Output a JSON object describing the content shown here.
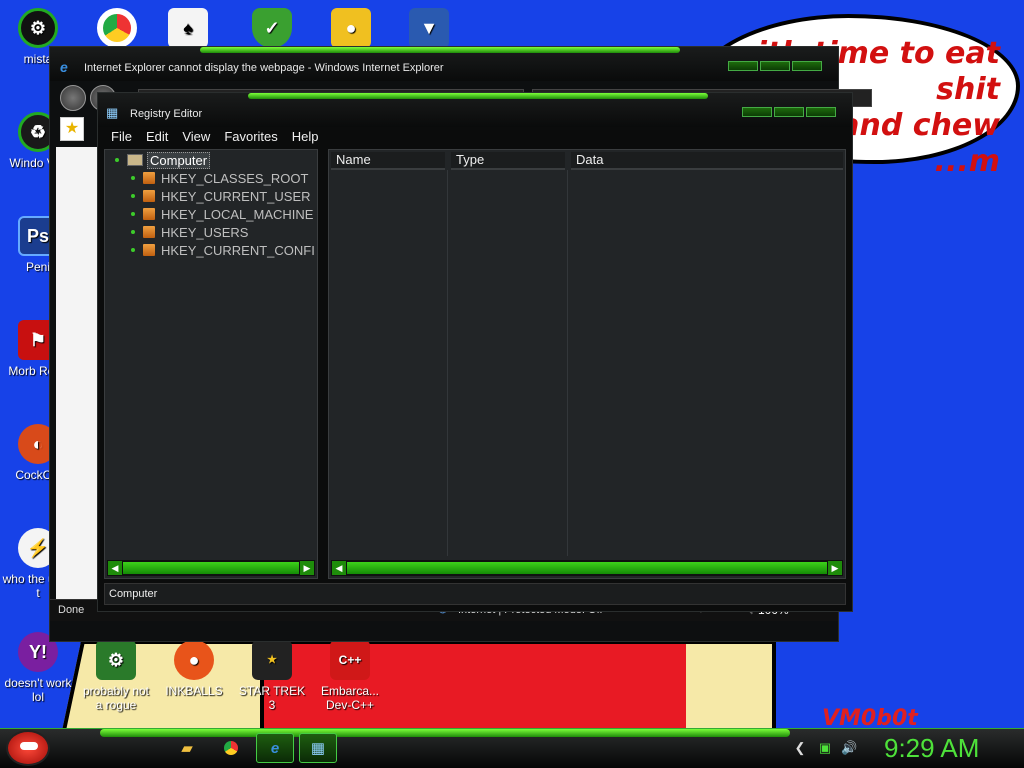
{
  "wallpaper": {
    "bubble_lines": [
      "...ith time to eat shit",
      "and chew",
      "...m"
    ],
    "signature": "VM0b0t"
  },
  "desktop_icons": [
    {
      "label": "mista",
      "icon": "gear-icon",
      "color": "#111"
    },
    {
      "label": "Windo Vist",
      "icon": "recycle-icon",
      "color": "#1a1a1a"
    },
    {
      "label": "Peni",
      "icon": "photoshop-icon",
      "color": "#1b3d8f"
    },
    {
      "label": "Morb Read",
      "icon": "pdf-icon",
      "color": "#c81010"
    },
    {
      "label": "CockClo",
      "icon": "browser-icon",
      "color": "#d84a1a"
    },
    {
      "label": "who the uses t",
      "icon": "lightning-icon",
      "color": "#e86010"
    },
    {
      "label": "doesn't work lol",
      "icon": "yahoo-messenger-icon",
      "color": "#7a1fa0"
    },
    {
      "label": "probably not a rogue",
      "icon": "gears-icon",
      "color": "#2a7a2a"
    },
    {
      "label": "INKBALLS",
      "icon": "inkball-icon",
      "color": "#e8541a"
    },
    {
      "label": "STAR TREK 3",
      "icon": "game-icon",
      "color": "#222"
    },
    {
      "label": "Embarca... Dev-C++",
      "icon": "devcpp-icon",
      "color": "#d01818"
    }
  ],
  "top_icons": [
    {
      "name": "chrome-icon",
      "color": "#e8e8e8"
    },
    {
      "name": "solitaire-icon",
      "color": "#f4f4f4"
    },
    {
      "name": "security-shield-icon",
      "color": "#3aa030"
    },
    {
      "name": "bad-piggies-icon",
      "color": "#f0c020"
    },
    {
      "name": "logo-icon",
      "color": "#2a5ab0"
    }
  ],
  "ie_window": {
    "title": "Internet Explorer cannot display the webpage - Windows Internet Explorer",
    "status_done": "Done",
    "status_zone": "Internet | Protected Mode: Off",
    "zoom": "100%"
  },
  "regedit": {
    "title": "Registry Editor",
    "menu": [
      "File",
      "Edit",
      "View",
      "Favorites",
      "Help"
    ],
    "tree_root": "Computer",
    "tree_items": [
      "HKEY_CLASSES_ROOT",
      "HKEY_CURRENT_USER",
      "HKEY_LOCAL_MACHINE",
      "HKEY_USERS",
      "HKEY_CURRENT_CONFI"
    ],
    "columns": [
      "Name",
      "Type",
      "Data"
    ],
    "status": "Computer"
  },
  "taskbar": {
    "clock": "9:29 AM"
  }
}
